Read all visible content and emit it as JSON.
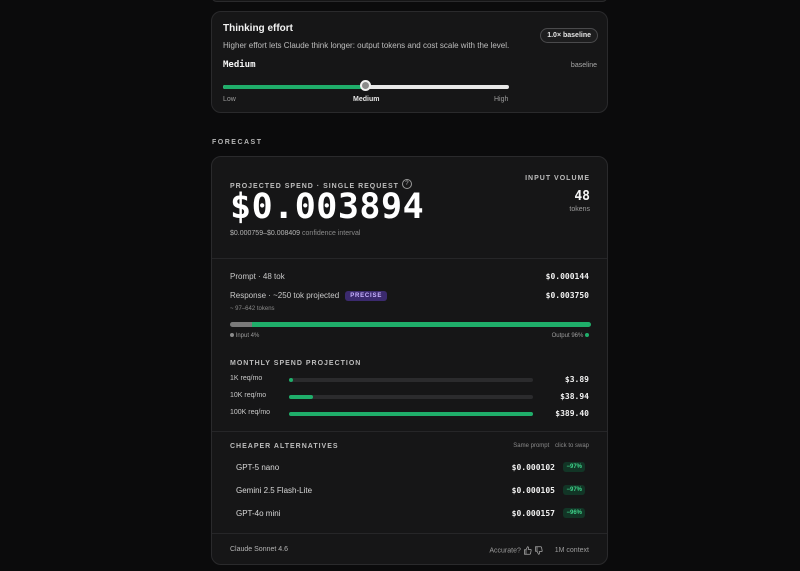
{
  "effort": {
    "title": "Thinking effort",
    "badge": "1.0× baseline",
    "description": "Higher effort lets Claude think longer: output tokens and cost scale with the level.",
    "level": "Medium",
    "level_note": "baseline",
    "slider_value_fraction": 0.5,
    "slider_labels": [
      "Low",
      "Medium",
      "High"
    ]
  },
  "forecast": {
    "heading": "FORECAST",
    "spend_label": "PROJECTED SPEND · SINGLE REQUEST",
    "info": "?",
    "spend_value": "$0.003894",
    "ci_range": "$0.000759–$0.008409",
    "ci_text": "confidence interval",
    "input_volume_label": "INPUT VOLUME",
    "input_volume_value": "48",
    "input_volume_unit": "tokens",
    "prompt_label": "Prompt · 48 tok",
    "prompt_value": "$0.000144",
    "response_label": "Response · ~250 tok projected",
    "response_badge": "PRECISE",
    "response_value": "$0.003750",
    "response_range": "~ 97–642 tokens",
    "split_input_pct": 4,
    "split_output_pct": 96,
    "legend_input": "Input 4%",
    "legend_output": "Output 96%"
  },
  "monthly": {
    "heading": "MONTHLY SPEND PROJECTION",
    "rows": [
      {
        "label": "1K req/mo",
        "value": "$3.89",
        "fraction": 0.01
      },
      {
        "label": "10K req/mo",
        "value": "$38.94",
        "fraction": 0.1
      },
      {
        "label": "100K req/mo",
        "value": "$389.40",
        "fraction": 1.0
      }
    ]
  },
  "alternatives": {
    "heading": "CHEAPER ALTERNATIVES",
    "hint_left": "Same prompt",
    "hint_right": "click to swap",
    "items": [
      {
        "name": "GPT-5 nano",
        "price": "$0.000102",
        "pct": "−97%"
      },
      {
        "name": "Gemini 2.5 Flash-Lite",
        "price": "$0.000105",
        "pct": "−97%"
      },
      {
        "name": "GPT-4o mini",
        "price": "$0.000157",
        "pct": "−96%"
      }
    ]
  },
  "footer": {
    "model": "Claude Sonnet 4.6",
    "accurate": "Accurate?",
    "context": "1M context"
  },
  "colors": {
    "accent_green": "#1fae6a",
    "precise_purple": "#3b2a6e",
    "background": "#0b0b0c"
  }
}
